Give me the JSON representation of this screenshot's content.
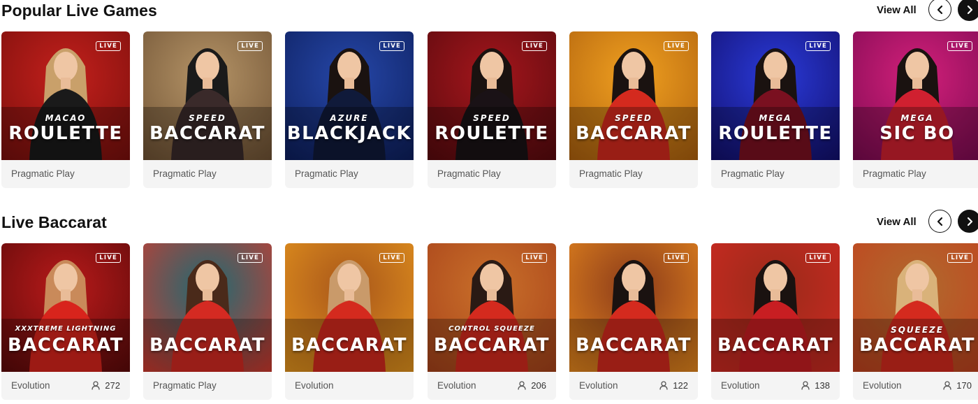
{
  "sections": [
    {
      "title": "Popular Live Games",
      "view_all": "View All",
      "prev_icon": "chevron-left",
      "next_icon": "chevron-right",
      "cards": [
        {
          "badge": "LIVE",
          "subtitle": "MACAO",
          "name": "ROULETTE",
          "provider": "Pragmatic Play",
          "players": "",
          "bg1": "#c3201c",
          "bg2": "#7a0f0c",
          "dress": "#1a1a1a",
          "hair": "#c9a06a"
        },
        {
          "badge": "LIVE",
          "subtitle": "SPEED",
          "name": "BACCARAT",
          "provider": "Pragmatic Play",
          "players": "",
          "bg1": "#b59467",
          "bg2": "#6f5234",
          "dress": "#3a2a2a",
          "hair": "#1a1a1a"
        },
        {
          "badge": "LIVE",
          "subtitle": "AZURE",
          "name": "BLACKJACK",
          "provider": "Pragmatic Play",
          "players": "",
          "bg1": "#2647a8",
          "bg2": "#0d1f5e",
          "dress": "#101a3a",
          "hair": "#1a1210"
        },
        {
          "badge": "LIVE",
          "subtitle": "SPEED",
          "name": "ROULETTE",
          "provider": "Pragmatic Play",
          "players": "",
          "bg1": "#a4161c",
          "bg2": "#5a0a0e",
          "dress": "#1a1216",
          "hair": "#1a1210"
        },
        {
          "badge": "LIVE",
          "subtitle": "SPEED",
          "name": "BACCARAT",
          "provider": "Pragmatic Play",
          "players": "",
          "bg1": "#f0a020",
          "bg2": "#b0620e",
          "dress": "#d42a1e",
          "hair": "#1a1210"
        },
        {
          "badge": "LIVE",
          "subtitle": "MEGA",
          "name": "ROULETTE",
          "provider": "Pragmatic Play",
          "players": "",
          "bg1": "#2a3ad8",
          "bg2": "#120f6e",
          "dress": "#7a1020",
          "hair": "#1a1210"
        },
        {
          "badge": "LIVE",
          "subtitle": "MEGA",
          "name": "SIC BO",
          "provider": "Pragmatic Play",
          "players": "",
          "bg1": "#d2207a",
          "bg2": "#7e0a52",
          "dress": "#d02030",
          "hair": "#1a1210"
        }
      ]
    },
    {
      "title": "Live Baccarat",
      "view_all": "View All",
      "prev_icon": "chevron-left",
      "next_icon": "chevron-right",
      "cards": [
        {
          "badge": "LIVE",
          "subtitle": "XXXTREME LIGHTNING",
          "name": "BACCARAT",
          "provider": "Evolution",
          "players": "272",
          "bg1": "#b81a1a",
          "bg2": "#5e0a0a",
          "dress": "#d8241c",
          "hair": "#c98a5a"
        },
        {
          "badge": "LIVE",
          "subtitle": "",
          "name": "BACCARAT",
          "provider": "Pragmatic Play",
          "players": "",
          "bg1": "#1f6a72",
          "bg2": "#d23a2e",
          "dress": "#d42a22",
          "hair": "#4a2a1a"
        },
        {
          "badge": "LIVE",
          "subtitle": "",
          "name": "BACCARAT",
          "provider": "Evolution",
          "players": "",
          "bg1": "#a8561a",
          "bg2": "#e6961e",
          "dress": "#d42a1e",
          "hair": "#c99a6a"
        },
        {
          "badge": "LIVE",
          "subtitle": "CONTROL SQUEEZE",
          "name": "BACCARAT",
          "provider": "Evolution",
          "players": "206",
          "bg1": "#c9702a",
          "bg2": "#a8421a",
          "dress": "#d42a1e",
          "hair": "#2a1a14"
        },
        {
          "badge": "LIVE",
          "subtitle": "",
          "name": "BACCARAT",
          "provider": "Evolution",
          "players": "122",
          "bg1": "#8a3a1a",
          "bg2": "#e8891e",
          "dress": "#d42a1e",
          "hair": "#1a1210"
        },
        {
          "badge": "LIVE",
          "subtitle": "",
          "name": "BACCARAT",
          "provider": "Evolution",
          "players": "138",
          "bg1": "#9a2a1a",
          "bg2": "#d02a22",
          "dress": "#c81e22",
          "hair": "#1a1210"
        },
        {
          "badge": "LIVE",
          "subtitle": "SQUEEZE",
          "name": "BACCARAT",
          "provider": "Evolution",
          "players": "170",
          "bg1": "#b06a2e",
          "bg2": "#c2421e",
          "dress": "#d42a1e",
          "hair": "#d9b27a"
        }
      ]
    }
  ]
}
